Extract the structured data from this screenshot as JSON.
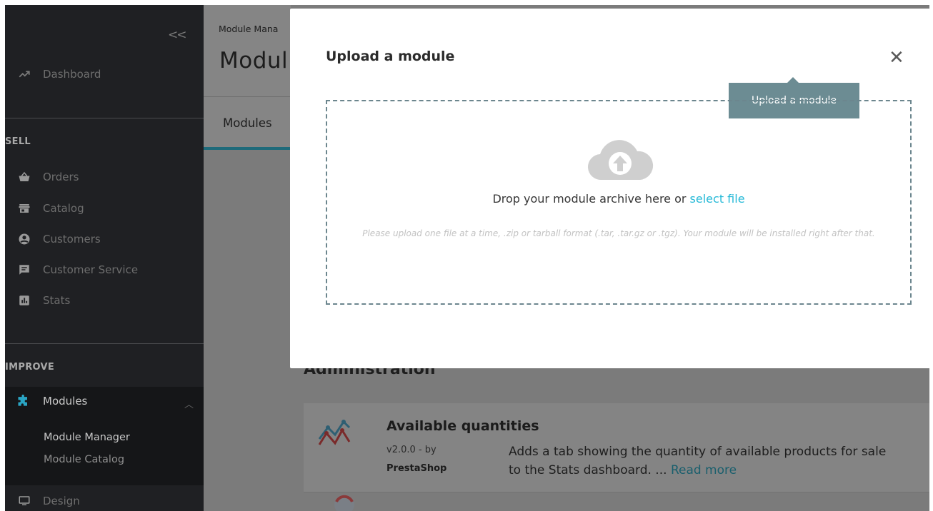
{
  "sidebar": {
    "collapse_glyph": "<<",
    "dashboard": "Dashboard",
    "sell_title": "SELL",
    "sell_items": [
      "Orders",
      "Catalog",
      "Customers",
      "Customer Service",
      "Stats"
    ],
    "improve_title": "IMPROVE",
    "modules": "Modules",
    "modules_sub": [
      "Module Manager",
      "Module Catalog"
    ],
    "design": "Design"
  },
  "header": {
    "breadcrumb": "Module Mana",
    "title": "Modul",
    "tab": "Modules"
  },
  "main": {
    "section_heading": "Administration",
    "module": {
      "name": "Available quantities",
      "version": "v2.0.0 - by",
      "author": "PrestaShop",
      "desc_line1": "Adds a tab showing the quantity of available products for sale",
      "desc_line2": "to the Stats dashboard. ... ",
      "read_more": "Read more"
    }
  },
  "modal": {
    "title": "Upload a module",
    "close_glyph": "✕",
    "drop_text": "Drop your module archive here or ",
    "select_file": "select file",
    "hint": "Please upload one file at a time, .zip or tarball format (.tar, .tar.gz or .tgz). Your module will be installed right after that.",
    "tooltip": "Upload a module"
  },
  "colors": {
    "sidebar_bg": "#1f2023",
    "accent_link": "#25b9d7",
    "tooltip_bg": "#6c8c93",
    "tab_underline": "#1e6a7a"
  }
}
